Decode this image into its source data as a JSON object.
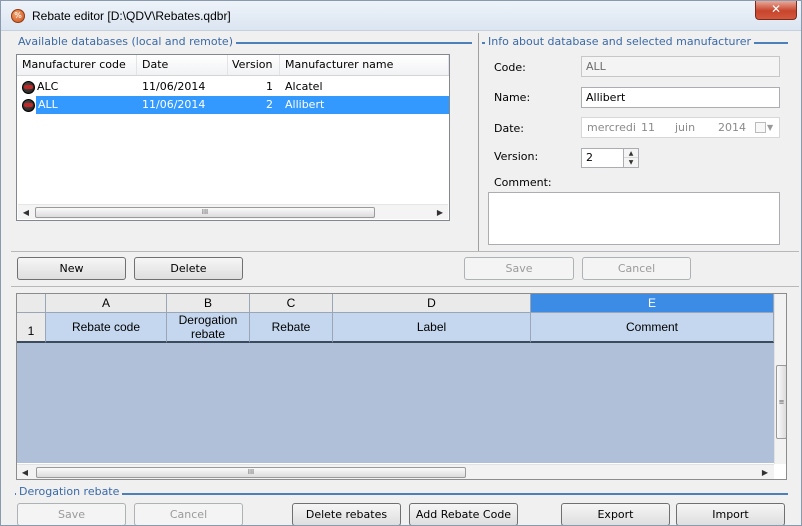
{
  "window": {
    "title": "Rebate editor [D:\\QDV\\Rebates.qdbr]",
    "close_label": "✕"
  },
  "databases_group": {
    "title": "Available databases (local and remote)",
    "columns": [
      "Manufacturer code",
      "Date",
      "Version",
      "Manufacturer name"
    ],
    "rows": [
      {
        "code": "ALC",
        "date": "11/06/2014",
        "version": "1",
        "name": "Alcatel",
        "selected": false
      },
      {
        "code": "ALL",
        "date": "11/06/2014",
        "version": "2",
        "name": "Allibert",
        "selected": true
      }
    ],
    "scroll_grip": "III"
  },
  "info_group": {
    "title": "Info about database and selected manufacturer",
    "code_label": "Code:",
    "code_value": "ALL",
    "name_label": "Name:",
    "name_value": "Allibert",
    "date_label": "Date:",
    "date_weekday": "mercredi",
    "date_day": "11",
    "date_month": "juin",
    "date_year": "2014",
    "version_label": "Version:",
    "version_value": "2",
    "comment_label": "Comment:",
    "comment_value": ""
  },
  "db_buttons": {
    "new": "New",
    "delete": "Delete",
    "save": "Save",
    "cancel": "Cancel"
  },
  "grid": {
    "column_letters": [
      "A",
      "B",
      "C",
      "D",
      "E"
    ],
    "active_column": "E",
    "row_number": "1",
    "field_headers": [
      "Rebate code",
      "Derogation rebate",
      "Rebate",
      "Label",
      "Comment"
    ],
    "scroll_grip": "III"
  },
  "derogation_group": {
    "title": "Derogation rebate"
  },
  "bottom_buttons": {
    "save": "Save",
    "cancel": "Cancel",
    "delete_rebates": "Delete rebates",
    "add_rebate_code": "Add Rebate Code",
    "export": "Export",
    "import": "Import"
  }
}
